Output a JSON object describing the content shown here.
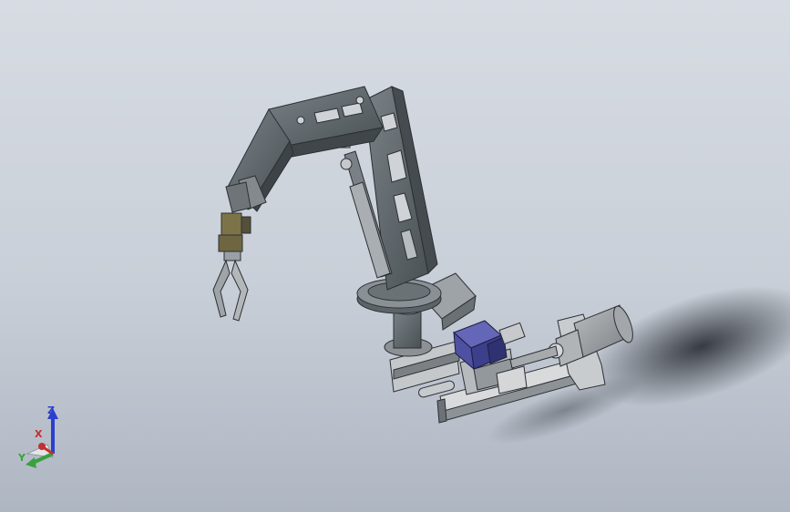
{
  "viewport": {
    "background_top": "#d7dce3",
    "background_bottom": "#aeb6c2",
    "model_color": "#5b6367",
    "motor_color": "#4a4e9c",
    "gripper_color": "#7c7448"
  },
  "triad": {
    "z_label": "Z",
    "x_label": "X",
    "y_label": "Y",
    "z_color": "#2a3fd0",
    "x_color": "#c23030",
    "y_color": "#3aa040"
  }
}
